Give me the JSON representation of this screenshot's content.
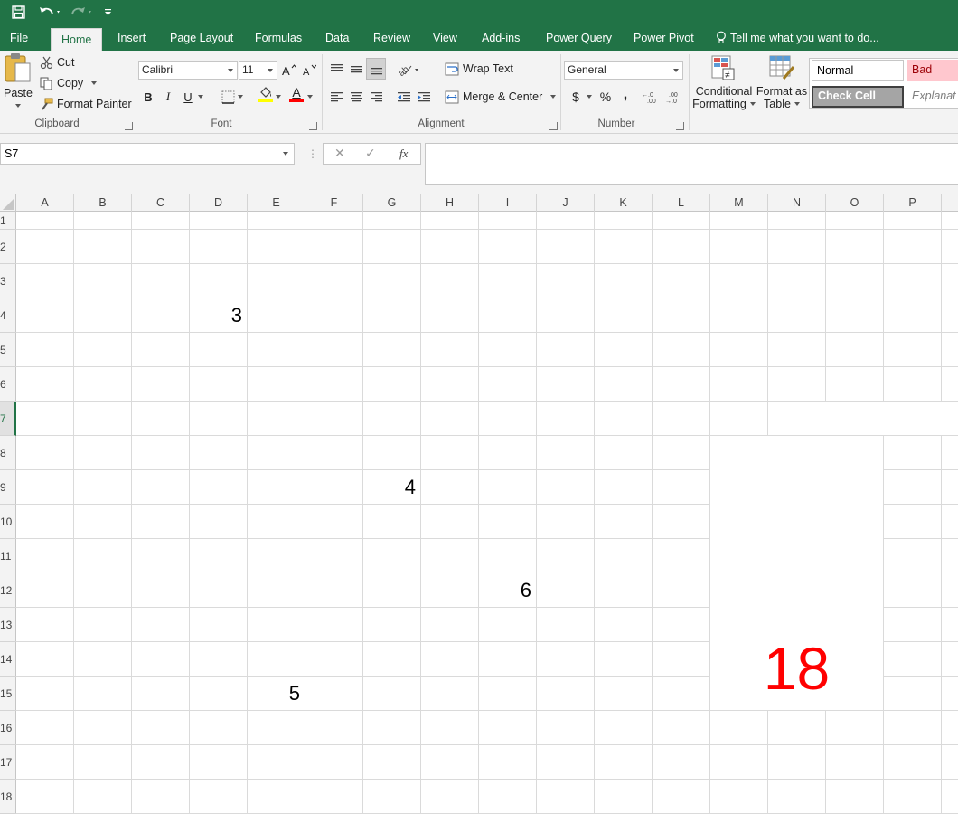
{
  "ribbon_tabs": [
    "File",
    "Home",
    "Insert",
    "Page Layout",
    "Formulas",
    "Data",
    "Review",
    "View",
    "Add-ins",
    "Power Query",
    "Power Pivot"
  ],
  "tell_me": "Tell me what you want to do...",
  "clipboard": {
    "paste": "Paste",
    "cut": "Cut",
    "copy": "Copy",
    "format_painter": "Format Painter",
    "group": "Clipboard"
  },
  "font": {
    "name": "Calibri",
    "size": "11",
    "bold": "B",
    "italic": "I",
    "underline": "U",
    "group": "Font",
    "highlight_color": "#ffff00",
    "font_color": "#ff0000"
  },
  "alignment": {
    "wrap_text": "Wrap Text",
    "merge_center": "Merge & Center",
    "group": "Alignment"
  },
  "number": {
    "format": "General",
    "currency": "$",
    "percent": "%",
    "comma": ",",
    "group": "Number"
  },
  "styles": {
    "conditional_1": "Conditional",
    "conditional_2": "Formatting",
    "format_as_1": "Format as",
    "format_as_2": "Table",
    "normal": "Normal",
    "bad": "Bad",
    "check_cell": "Check Cell",
    "explanatory": "Explanat"
  },
  "formula_bar": {
    "name_box": "S7",
    "fx": "fx",
    "value": ""
  },
  "columns": [
    "A",
    "B",
    "C",
    "D",
    "E",
    "F",
    "G",
    "H",
    "I",
    "J",
    "K",
    "L",
    "M",
    "N",
    "O",
    "P"
  ],
  "rows": [
    "1",
    "2",
    "3",
    "4",
    "5",
    "6",
    "7",
    "8",
    "9",
    "10",
    "11",
    "12",
    "13",
    "14",
    "15",
    "16",
    "17",
    "18"
  ],
  "active_row": "7",
  "cells": {
    "d4": "3",
    "g9": "4",
    "i12": "6",
    "e15": "5",
    "merged_total": "18",
    "merged_total_color": "#ff0000"
  },
  "colors": {
    "brand": "#217346"
  }
}
